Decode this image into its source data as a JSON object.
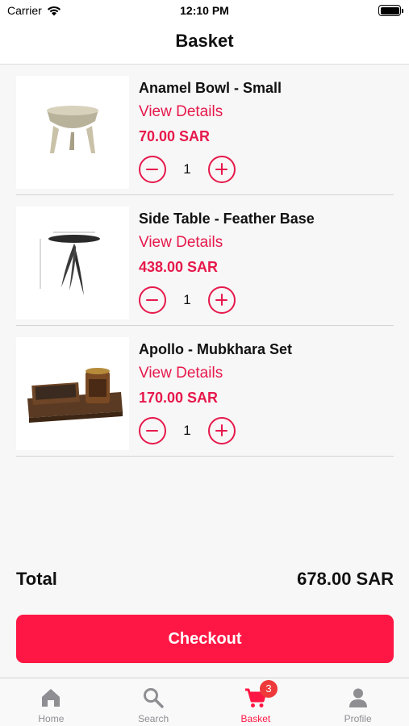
{
  "status_bar": {
    "carrier": "Carrier",
    "time": "12:10 PM"
  },
  "header": {
    "title": "Basket"
  },
  "items": [
    {
      "name": "Anamel Bowl - Small",
      "details_label": "View Details",
      "price": "70.00 SAR",
      "quantity": "1",
      "thumb_icon": "bowl-image"
    },
    {
      "name": "Side Table - Feather Base",
      "details_label": "View Details",
      "price": "438.00 SAR",
      "quantity": "1",
      "thumb_icon": "side-table-image"
    },
    {
      "name": "Apollo - Mubkhara Set",
      "details_label": "View Details",
      "price": "170.00 SAR",
      "quantity": "1",
      "thumb_icon": "mubkhara-set-image"
    }
  ],
  "total": {
    "label": "Total",
    "amount": "678.00 SAR"
  },
  "checkout": {
    "label": "Checkout"
  },
  "tabs": [
    {
      "label": "Home",
      "icon": "home-icon"
    },
    {
      "label": "Search",
      "icon": "search-icon"
    },
    {
      "label": "Basket",
      "icon": "cart-icon",
      "badge": "3",
      "active": true
    },
    {
      "label": "Profile",
      "icon": "profile-icon"
    }
  ],
  "colors": {
    "accent": "#fe1744",
    "price": "#e6194b",
    "inactive_tab": "#8e8e93"
  }
}
